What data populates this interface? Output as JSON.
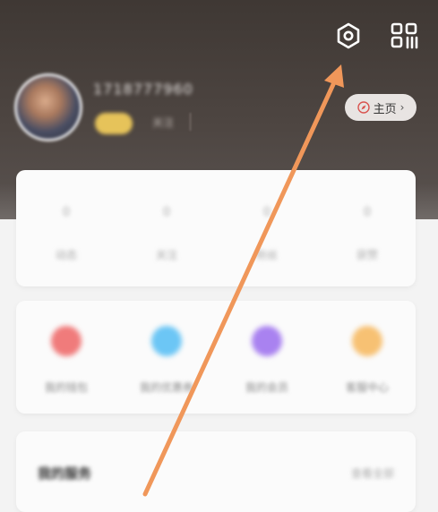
{
  "header": {
    "username": "1718777960",
    "level_badge": "",
    "follow_text": "关注"
  },
  "home_button": {
    "label": "主页",
    "chevron": "›"
  },
  "icons": {
    "settings": "settings-hexagon-icon",
    "scan": "qr-scan-icon",
    "home": "compass-icon"
  },
  "stats": [
    {
      "value": "0",
      "label": "动态"
    },
    {
      "value": "0",
      "label": "关注"
    },
    {
      "value": "0",
      "label": "粉丝"
    },
    {
      "value": "0",
      "label": "获赞"
    }
  ],
  "services": [
    {
      "label": "我的钱包",
      "color": "#f07b7b"
    },
    {
      "label": "我的优惠券",
      "color": "#6cc6f5"
    },
    {
      "label": "我的会员",
      "color": "#a982f0"
    },
    {
      "label": "客服中心",
      "color": "#f7c173"
    }
  ],
  "section": {
    "title": "我的服务",
    "more": "查看全部"
  },
  "colors": {
    "annotation_arrow": "#f0975a",
    "header_dark": "#3f3834"
  }
}
